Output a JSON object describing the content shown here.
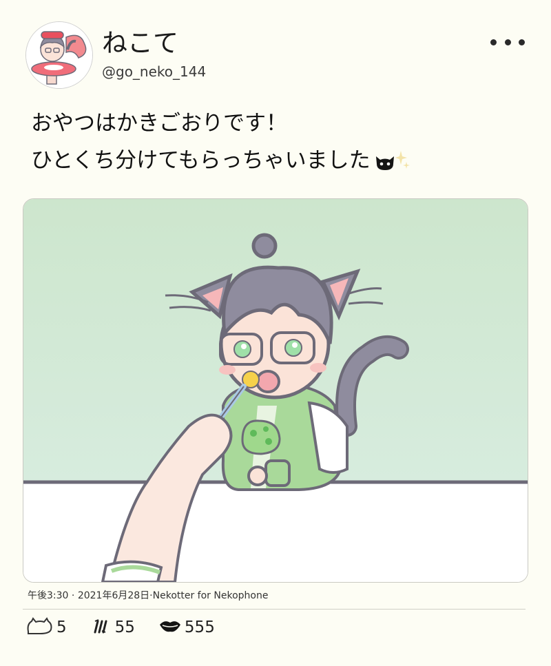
{
  "author": {
    "display_name": "ねこて",
    "handle": "@go_neko_144"
  },
  "post": {
    "lines": [
      "おやつはかきごおりです！",
      "ひとくち分けてもらっちゃいました"
    ],
    "emoji": [
      "cat-face-icon",
      "sparkle-icon"
    ]
  },
  "meta": {
    "time": "午後3:30",
    "separator": " · ",
    "date": "2021年6月28日",
    "via": "·Nekotter for Nekophone"
  },
  "stats": {
    "replies": "5",
    "retweets": "55",
    "likes": "555"
  },
  "colors": {
    "background": "#fdfdf4",
    "image_wall_top": "#cde6cd",
    "image_wall_bottom": "#d7ecde",
    "jacket_green": "#a9d99a",
    "hair_gray": "#8f8c9e"
  }
}
